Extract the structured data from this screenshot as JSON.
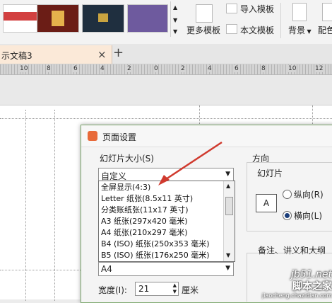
{
  "ribbon": {
    "import_template": "导入模板",
    "more_templates": "更多模板",
    "text_template": "本文模板",
    "background": "背景",
    "color_scheme_partial": "配色",
    "thumb_colors": [
      "#d24040",
      "#6b1d16",
      "#1f2f3f",
      "#6e5a9e"
    ]
  },
  "tabs": {
    "active_tab": "示文稿3",
    "close": "×",
    "add": "+"
  },
  "ruler": {
    "labels": [
      "10",
      "8",
      "6",
      "4",
      "2",
      "0",
      "2",
      "4",
      "6",
      "8",
      "10",
      "12"
    ]
  },
  "dialog": {
    "title": "页面设置",
    "size_label": "幻灯片大小(S)",
    "size_value": "自定义",
    "size_options": [
      "全屏显示(4:3)",
      "Letter 纸张(8.5x11 英寸)",
      "分类账纸张(11x17 英寸)",
      "A3 纸张(297x420 毫米)",
      "A4 纸张(210x297 毫米)",
      "B4 (ISO) 纸张(250x353 毫米)",
      "B5 (ISO) 纸张(176x250 毫米)"
    ],
    "second_select_value": "A4",
    "width_label": "宽度(I):",
    "width_value": "21",
    "width_unit": "厘米",
    "orientation_title": "方向",
    "slides_label": "幻灯片",
    "portrait": "纵向(R)",
    "landscape": "横向(L)",
    "notes_label": "备注、讲义和大纲",
    "accent_color": "#d03a2e"
  },
  "watermark": {
    "line1": "jb51.net",
    "line2": "脚本之家",
    "line3": "jiaocheng.chazidian.com"
  }
}
